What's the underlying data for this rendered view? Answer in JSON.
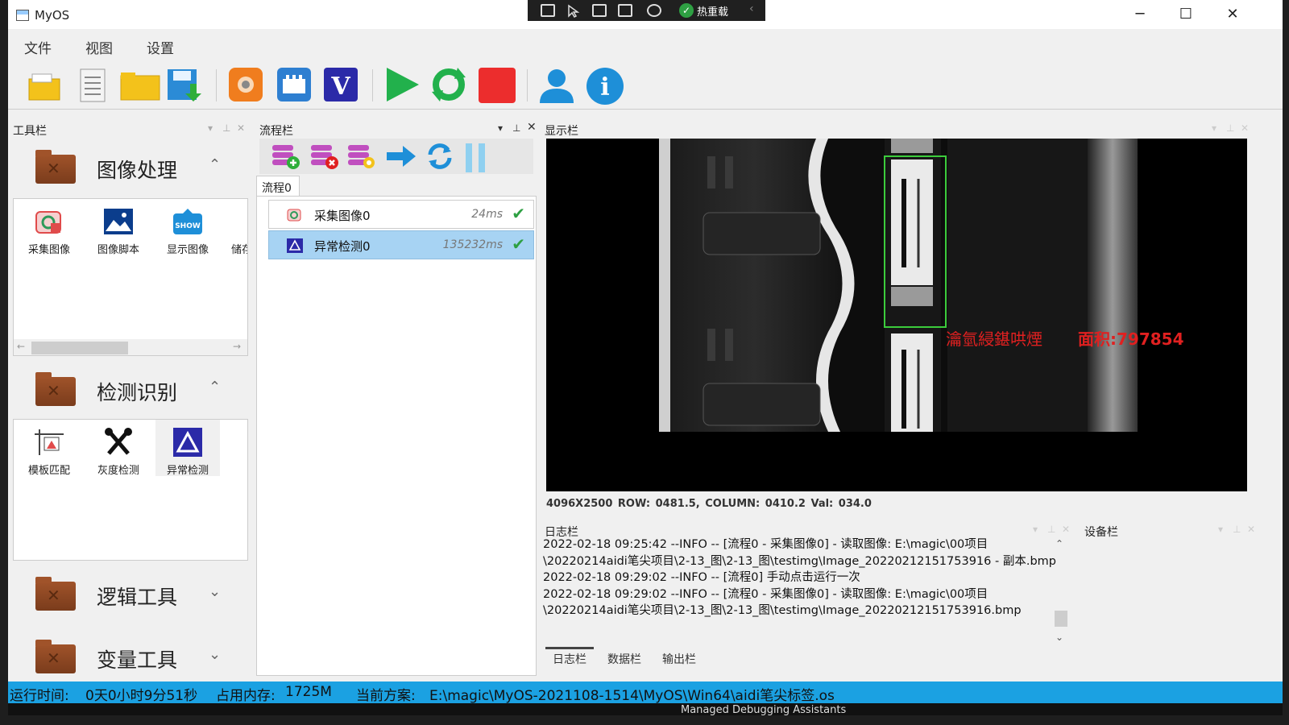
{
  "window": {
    "title": "MyOS",
    "minimize": "─",
    "maximize": "☐",
    "close": "✕"
  },
  "hot_reload": {
    "label": "热重载"
  },
  "menu": [
    "文件",
    "视图",
    "设置"
  ],
  "toolbar": {
    "icons": [
      "open-project-icon",
      "new-document-icon",
      "open-folder-icon",
      "save-icon",
      "camera-icon",
      "network-icon",
      "vision-icon",
      "run-icon",
      "loop-run-icon",
      "stop-icon",
      "user-icon",
      "info-icon"
    ],
    "vision_letter": "V",
    "info_letter": "i"
  },
  "tool_panel": {
    "title": "工具栏",
    "categories": [
      {
        "label": "图像处理",
        "chevron": "⌃",
        "tools": [
          "采集图像",
          "图像脚本",
          "显示图像",
          "储存"
        ]
      },
      {
        "label": "检测识别",
        "chevron": "⌃",
        "tools": [
          "模板匹配",
          "灰度检测",
          "异常检测"
        ]
      },
      {
        "label": "逻辑工具",
        "chevron": "⌄"
      },
      {
        "label": "变量工具",
        "chevron": "⌄"
      }
    ],
    "show_badge": "SHOW"
  },
  "flow_panel": {
    "title": "流程栏",
    "tab": "流程0",
    "rows": [
      {
        "name": "采集图像0",
        "time": "24ms",
        "check": "✔"
      },
      {
        "name": "异常检测0",
        "time": "135232ms",
        "check": "✔"
      }
    ]
  },
  "display_panel": {
    "title": "显示栏",
    "overlay_text": "瀹氫綅鍖哄煙",
    "area_text": "面积:797854",
    "status": "4096X2500    ROW: 0481.5, COLUMN: 0410.2    Val: 034.0"
  },
  "log_panel": {
    "title": "日志栏",
    "lines": [
      "2022-02-18 09:25:42 --INFO -- [流程0 - 采集图像0] - 读取图像: E:\\magic\\00项目",
      "\\20220214aidi笔尖项目\\2-13_图\\2-13_图\\testimg\\Image_20220212151753916 - 副本.bmp",
      "2022-02-18 09:29:02 --INFO -- [流程0] 手动点击运行一次",
      "2022-02-18 09:29:02 --INFO -- [流程0 - 采集图像0] - 读取图像: E:\\magic\\00项目",
      "\\20220214aidi笔尖项目\\2-13_图\\2-13_图\\testimg\\Image_20220212151753916.bmp"
    ],
    "tabs": [
      "日志栏",
      "数据栏",
      "输出栏"
    ]
  },
  "device_panel": {
    "title": "设备栏"
  },
  "status_bar": {
    "runtime_label": "运行时间:",
    "runtime_value": "0天0小时9分51秒",
    "memory_label": "占用内存:",
    "memory_value": "1725M",
    "scheme_label": "当前方案:",
    "scheme_value": "E:\\magic\\MyOS-2021108-1514\\MyOS\\Win64\\aidi笔尖标签.os"
  },
  "background_text": "Managed Debugging Assistants",
  "colors": {
    "accent": "#1ba1e2",
    "selection": "#a7d3f3",
    "detect_box": "#3ccc3c",
    "overlay_text": "#e02020"
  }
}
